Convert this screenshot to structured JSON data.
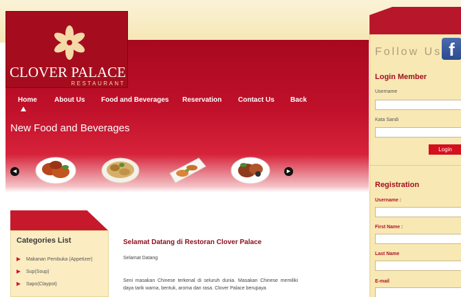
{
  "brand": {
    "name": "CLOVER PALACE",
    "subtitle": "RESTAURANT"
  },
  "nav": {
    "items": [
      "Home",
      "About Us",
      "Food and Beverages",
      "Reservation",
      "Contact Us",
      "Back"
    ]
  },
  "section": {
    "title": "New Food and Beverages"
  },
  "carousel": {
    "prev_icon": "chevron-left-icon",
    "next_icon": "chevron-right-icon"
  },
  "sidebar": {
    "follow_label": "Follow Us",
    "facebook_letter": "f",
    "login": {
      "title": "Login Member",
      "username_label": "Username",
      "password_label": "Kata Sandi",
      "button_label": "Login"
    },
    "registration": {
      "title": "Registration",
      "username_label": "Username :",
      "first_name_label": "First Name :",
      "last_name_label": "Last Name",
      "email_label": "E-mail"
    }
  },
  "categories": {
    "title": "Categories List",
    "items": [
      "Makanan Pembuka (Appetizer)",
      "Sup(Soup)",
      "Sapo(Claypot)"
    ]
  },
  "welcome": {
    "title": "Selamat Datang di Restoran Clover Palace",
    "subtitle": "Selamat Datang",
    "body": "Seni masakan Chinese terkenal di seluruh dunia. Masakan Chinese memiliki daya tarik warna, bentuk, aroma dan rasa. Clover Palace berupaya"
  },
  "colors": {
    "brand_red": "#b8162a",
    "cream": "#f8e8b4",
    "button_red": "#d4101e",
    "title_red": "#a30d1e"
  }
}
